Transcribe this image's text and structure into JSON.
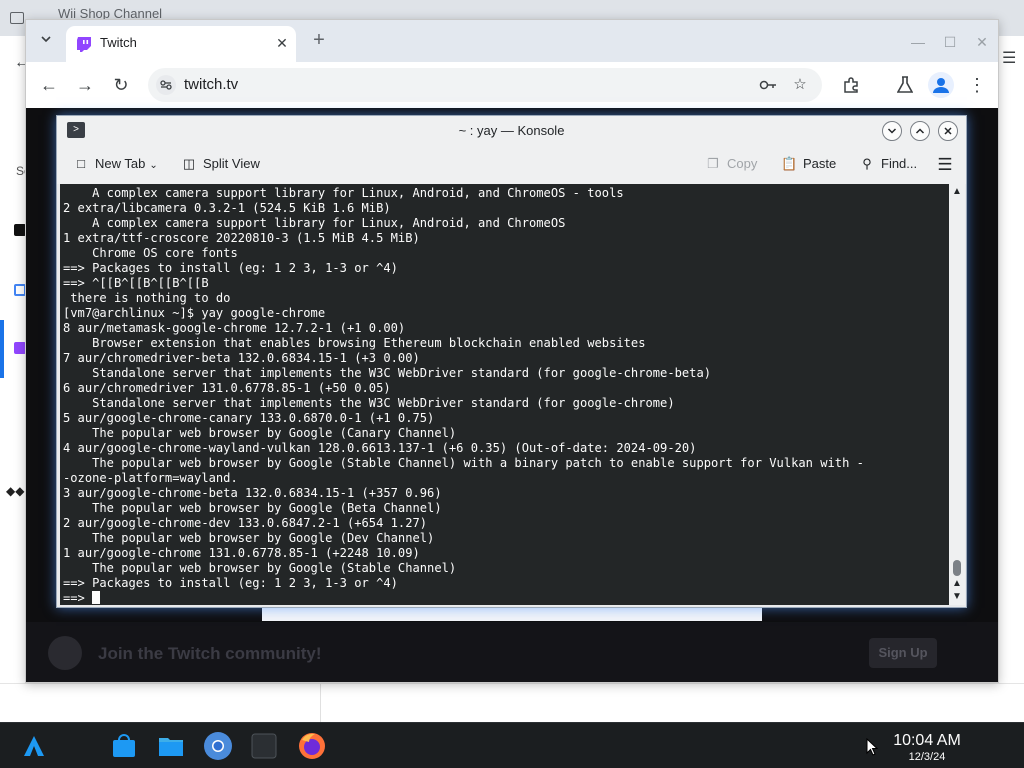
{
  "background_browser": {
    "tabs": [
      "Wii Shop Channel",
      "",
      "",
      "",
      ""
    ]
  },
  "browser": {
    "tab": {
      "title": "Twitch"
    },
    "omnibox": {
      "url": "twitch.tv"
    },
    "page": {
      "join_text": "Join the Twitch community!",
      "signup_label": "Sign Up"
    }
  },
  "konsole": {
    "title": "~ : yay — Konsole",
    "toolbar": {
      "new_tab": "New Tab",
      "split_view": "Split View",
      "copy": "Copy",
      "paste": "Paste",
      "find": "Find..."
    },
    "terminal_lines": [
      "    A complex camera support library for Linux, Android, and ChromeOS - tools",
      "2 extra/libcamera 0.3.2-1 (524.5 KiB 1.6 MiB)",
      "    A complex camera support library for Linux, Android, and ChromeOS",
      "1 extra/ttf-croscore 20220810-3 (1.5 MiB 4.5 MiB)",
      "    Chrome OS core fonts",
      "==> Packages to install (eg: 1 2 3, 1-3 or ^4)",
      "==> ^[[B^[[B^[[B^[[B",
      " there is nothing to do",
      "[vm7@archlinux ~]$ yay google-chrome",
      "8 aur/metamask-google-chrome 12.7.2-1 (+1 0.00)",
      "    Browser extension that enables browsing Ethereum blockchain enabled websites",
      "7 aur/chromedriver-beta 132.0.6834.15-1 (+3 0.00)",
      "    Standalone server that implements the W3C WebDriver standard (for google-chrome-beta)",
      "6 aur/chromedriver 131.0.6778.85-1 (+50 0.05)",
      "    Standalone server that implements the W3C WebDriver standard (for google-chrome)",
      "5 aur/google-chrome-canary 133.0.6870.0-1 (+1 0.75)",
      "    The popular web browser by Google (Canary Channel)",
      "4 aur/google-chrome-wayland-vulkan 128.0.6613.137-1 (+6 0.35) (Out-of-date: 2024-09-20)",
      "    The popular web browser by Google (Stable Channel) with a binary patch to enable support for Vulkan with -",
      "-ozone-platform=wayland.",
      "3 aur/google-chrome-beta 132.0.6834.15-1 (+357 0.96)",
      "    The popular web browser by Google (Beta Channel)",
      "2 aur/google-chrome-dev 133.0.6847.2-1 (+654 1.27)",
      "    The popular web browser by Google (Dev Channel)",
      "1 aur/google-chrome 131.0.6778.85-1 (+2248 10.09)",
      "    The popular web browser by Google (Stable Channel)",
      "==> Packages to install (eg: 1 2 3, 1-3 or ^4)"
    ],
    "prompt": "==> "
  },
  "taskbar": {
    "time": "10:04 AM",
    "date": "12/3/24",
    "icons": [
      "app-launcher-icon",
      "discover-store-icon",
      "file-manager-icon",
      "chromium-icon",
      "konsole-icon",
      "firefox-icon"
    ]
  },
  "colors": {
    "terminal_bg": "#232627",
    "terminal_fg": "#fcfcfc",
    "twitch_purple": "#9146ff",
    "taskbar_bg": "#1b1e20",
    "plasma_blue": "#1d99f3"
  }
}
